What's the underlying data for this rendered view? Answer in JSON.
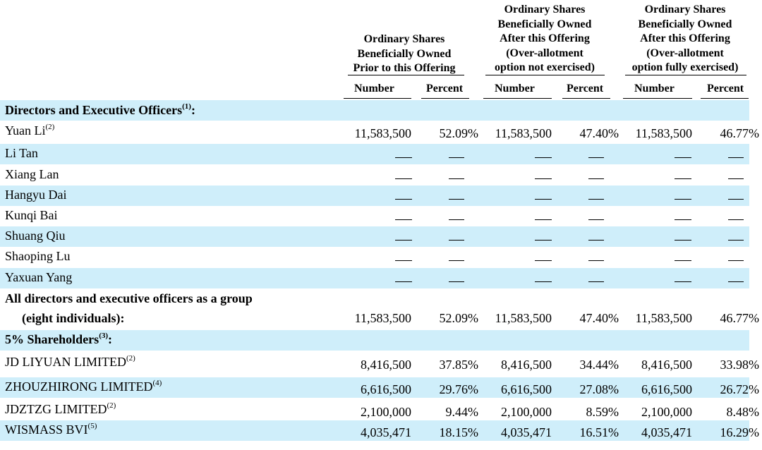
{
  "headers": {
    "group1": [
      "Ordinary Shares",
      "Beneficially Owned",
      "Prior to this Offering"
    ],
    "group2": [
      "Ordinary Shares",
      "Beneficially Owned",
      "After this Offering",
      "(Over-allotment",
      "option not exercised)"
    ],
    "group3": [
      "Ordinary Shares",
      "Beneficially Owned",
      "After this Offering",
      "(Over-allotment",
      "option fully exercised)"
    ],
    "number_label": "Number",
    "percent_label": "Percent"
  },
  "sections": {
    "directors": {
      "label": "Directors and Executive Officers",
      "note": "(1)",
      "suffix": ":"
    },
    "shareholders": {
      "label": "5% Shareholders",
      "note": "(3)",
      "suffix": ":"
    }
  },
  "dash": "—",
  "rows": [
    {
      "name": "Yuan Li",
      "note": "(2)",
      "values": [
        "11,583,500",
        "52.09%",
        "11,583,500",
        "47.40%",
        "11,583,500",
        "46.77%"
      ]
    },
    {
      "name": "Li Tan"
    },
    {
      "name": "Xiang Lan"
    },
    {
      "name": "Hangyu Dai"
    },
    {
      "name": "Kunqi Bai"
    },
    {
      "name": "Shuang Qiu"
    },
    {
      "name": "Shaoping Lu"
    },
    {
      "name": "Yaxuan Yang"
    }
  ],
  "group_total": {
    "line1": "All directors and executive officers as a group",
    "line2": "(eight individuals):",
    "values": [
      "11,583,500",
      "52.09%",
      "11,583,500",
      "47.40%",
      "11,583,500",
      "46.77%"
    ]
  },
  "holders": [
    {
      "name": "JD LIYUAN LIMITED",
      "note": "(2)",
      "values": [
        "8,416,500",
        "37.85%",
        "8,416,500",
        "34.44%",
        "8,416,500",
        "33.98%"
      ]
    },
    {
      "name": "ZHOUZHIRONG LIMITED",
      "note": "(4)",
      "values": [
        "6,616,500",
        "29.76%",
        "6,616,500",
        "27.08%",
        "6,616,500",
        "26.72%"
      ]
    },
    {
      "name": "JDZTZG LIMITED",
      "note": "(2)",
      "values": [
        "2,100,000",
        "9.44%",
        "2,100,000",
        "8.59%",
        "2,100,000",
        "8.48%"
      ]
    },
    {
      "name": "WISMASS BVI",
      "note": "(5)",
      "values": [
        "4,035,471",
        "18.15%",
        "4,035,471",
        "16.51%",
        "4,035,471",
        "16.29%"
      ]
    }
  ]
}
